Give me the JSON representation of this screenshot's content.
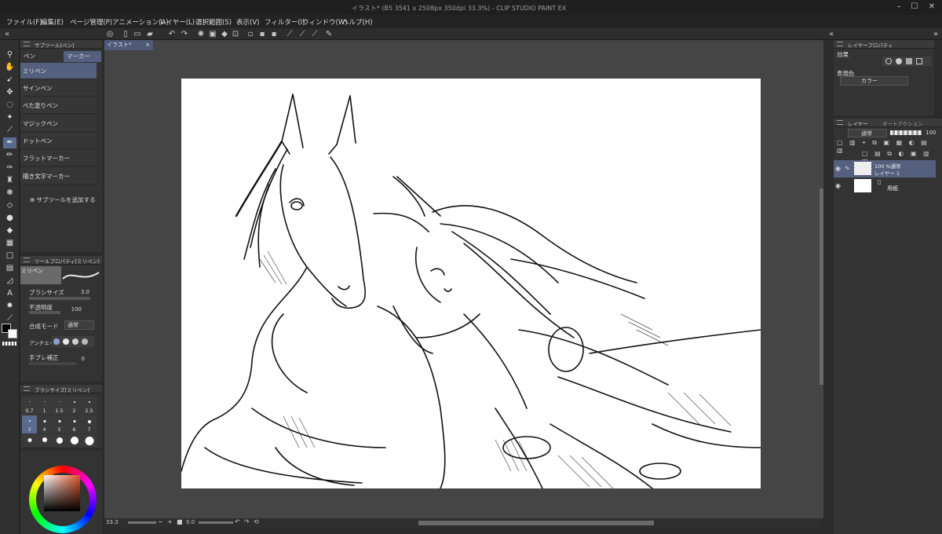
{
  "window": {
    "title": "イラスト* (B5 3541 x 2508px 350dpi 33.3%)  - CLIP STUDIO PAINT EX"
  },
  "menu": [
    {
      "label": "ファイル(F)"
    },
    {
      "label": "編集(E)"
    },
    {
      "label": "ページ管理(P)"
    },
    {
      "label": "アニメーション(A)"
    },
    {
      "label": "レイヤー(L)"
    },
    {
      "label": "選択範囲(S)"
    },
    {
      "label": "表示(V)"
    },
    {
      "label": "フィルター(I)"
    },
    {
      "label": "ウィンドウ(W)"
    },
    {
      "label": "ヘルプ(H)"
    }
  ],
  "subtool_panel": {
    "title": "サブツール[ペン]",
    "tabs": [
      "ペン",
      "マーカー"
    ],
    "items": [
      "ミリペン",
      "サインペン",
      "べた塗りペン",
      "マジックペン",
      "ドットペン",
      "フラットマーカー",
      "描き文字マーカー"
    ],
    "add_label": "サブツールを追加する"
  },
  "tool_property": {
    "title": "ツールプロパティ[ミリペン]",
    "preview_label": "ミリペン",
    "brush_size_label": "ブラシサイズ",
    "brush_size_value": "3.0",
    "opacity_label": "不透明度",
    "opacity_value": "100",
    "blend_label": "合成モード",
    "blend_value": "通常",
    "antialias_label": "アンチエイリ",
    "stabilization_label": "手ブレ補正",
    "stabilization_value": "0"
  },
  "brush_size_panel": {
    "title": "ブラシサイズ[ミリペン]",
    "row1": [
      "0.7",
      "1",
      "1.5",
      "2",
      "2.5"
    ],
    "row2": [
      "3",
      "4",
      "5",
      "6",
      "7"
    ]
  },
  "document": {
    "tab_label": "イラスト*",
    "zoom": "33.3",
    "angle": "0.0"
  },
  "layer_property": {
    "title": "レイヤープロパティ",
    "effect_label": "効果",
    "color_label": "表現色",
    "color_value": "カラー"
  },
  "layer_panel": {
    "tabs": [
      "レイヤー",
      "オートアクション"
    ],
    "blend_mode": "通常",
    "opacity": "100",
    "layers": [
      {
        "line1": "100 %通常",
        "line2": "レイヤー 1"
      },
      {
        "line1": "",
        "line2": "用紙"
      }
    ]
  },
  "colors": {
    "accent": "#5a6b8f",
    "panel_bg": "#333333",
    "canvas_bg": "#454545"
  }
}
